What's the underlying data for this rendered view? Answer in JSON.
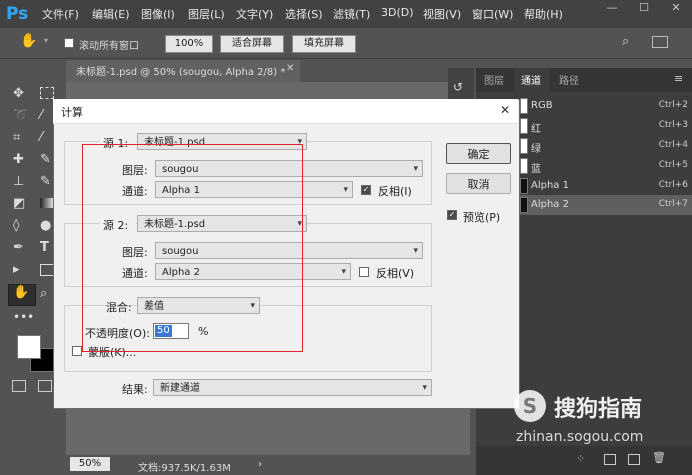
{
  "app": {
    "logo": "Ps"
  },
  "menu": [
    "文件(F)",
    "编辑(E)",
    "图像(I)",
    "图层(L)",
    "文字(Y)",
    "选择(S)",
    "滤镜(T)",
    "3D(D)",
    "视图(V)",
    "窗口(W)",
    "帮助(H)"
  ],
  "options_bar": {
    "scroll_all_label": "滚动所有窗口",
    "zoom_value": "100%",
    "fit_screen": "适合屏幕",
    "fill_screen": "填充屏幕"
  },
  "document": {
    "tab_label": "未标题-1.psd @ 50% (sougou, Alpha 2/8) *",
    "zoom": "50%",
    "doc_info": "文档:937.5K/1.63M"
  },
  "panel": {
    "tabs": [
      "图层",
      "通道",
      "路径"
    ],
    "channels": [
      {
        "name": "RGB",
        "shortcut": "Ctrl+2"
      },
      {
        "name": "红",
        "shortcut": "Ctrl+3"
      },
      {
        "name": "绿",
        "shortcut": "Ctrl+4"
      },
      {
        "name": "蓝",
        "shortcut": "Ctrl+5"
      },
      {
        "name": "Alpha 1",
        "shortcut": "Ctrl+6"
      },
      {
        "name": "Alpha 2",
        "shortcut": "Ctrl+7"
      }
    ]
  },
  "dialog": {
    "title": "计算",
    "source1": {
      "label": "源 1:",
      "file": "未标题-1.psd",
      "layer_label": "图层:",
      "layer": "sougou",
      "channel_label": "通道:",
      "channel": "Alpha 1",
      "invert_label": "反相(I)",
      "invert": true
    },
    "source2": {
      "label": "源 2:",
      "file": "未标题-1.psd",
      "layer_label": "图层:",
      "layer": "sougou",
      "channel_label": "通道:",
      "channel": "Alpha 2",
      "invert_label": "反相(V)",
      "invert": false
    },
    "blend_label": "混合:",
    "blend": "差值",
    "opacity_label": "不透明度(O):",
    "opacity": "50",
    "opacity_unit": "%",
    "mask_label": "蒙版(K)...",
    "result_label": "结果:",
    "result": "新建通道",
    "ok": "确定",
    "cancel": "取消",
    "preview_label": "预览(P)",
    "close": "✕"
  },
  "watermark": {
    "brand": "搜狗指南",
    "url": "zhinan.sogou.com"
  },
  "colors": {
    "accent_red": "#e0242c",
    "ps_blue": "#31a8ff"
  }
}
